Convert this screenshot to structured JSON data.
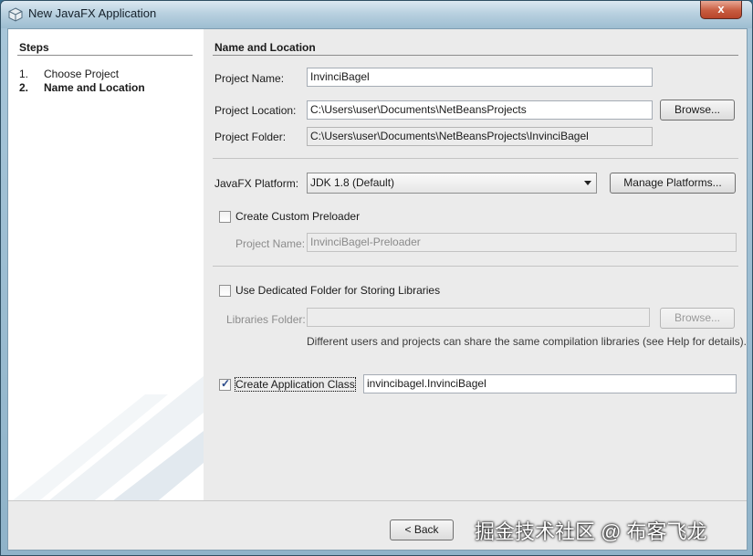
{
  "window": {
    "title": "New JavaFX Application",
    "close_label": "x"
  },
  "steps": {
    "title": "Steps",
    "items": [
      {
        "num": "1.",
        "label": "Choose Project"
      },
      {
        "num": "2.",
        "label": "Name and Location"
      }
    ]
  },
  "main": {
    "title": "Name and Location",
    "project_name_label": "Project Name:",
    "project_name_value": "InvinciBagel",
    "project_location_label": "Project Location:",
    "project_location_value": "C:\\Users\\user\\Documents\\NetBeansProjects",
    "browse_label": "Browse...",
    "project_folder_label": "Project Folder:",
    "project_folder_value": "C:\\Users\\user\\Documents\\NetBeansProjects\\InvinciBagel",
    "platform_label": "JavaFX Platform:",
    "platform_value": "JDK 1.8 (Default)",
    "manage_platforms_label": "Manage Platforms...",
    "preloader_label": "Create Custom Preloader",
    "preloader_checked": false,
    "preloader_project_label": "Project Name:",
    "preloader_project_value": "InvinciBagel-Preloader",
    "dedicated_folder_label": "Use Dedicated Folder for Storing Libraries",
    "dedicated_folder_checked": false,
    "libraries_folder_label": "Libraries Folder:",
    "libraries_folder_value": "",
    "libraries_browse_label": "Browse...",
    "libraries_note": "Different users and projects can share the same compilation libraries (see Help for details).",
    "app_class_label": "Create Application Class",
    "app_class_checked": true,
    "app_class_value": "invincibagel.InvinciBagel"
  },
  "footer": {
    "back_label": "< Back",
    "watermark": "掘金技术社区 @ 布客飞龙"
  },
  "colors": {
    "title_text": "#15202a",
    "close_button": "#c85c40",
    "panel_bg": "#ebebeb"
  }
}
